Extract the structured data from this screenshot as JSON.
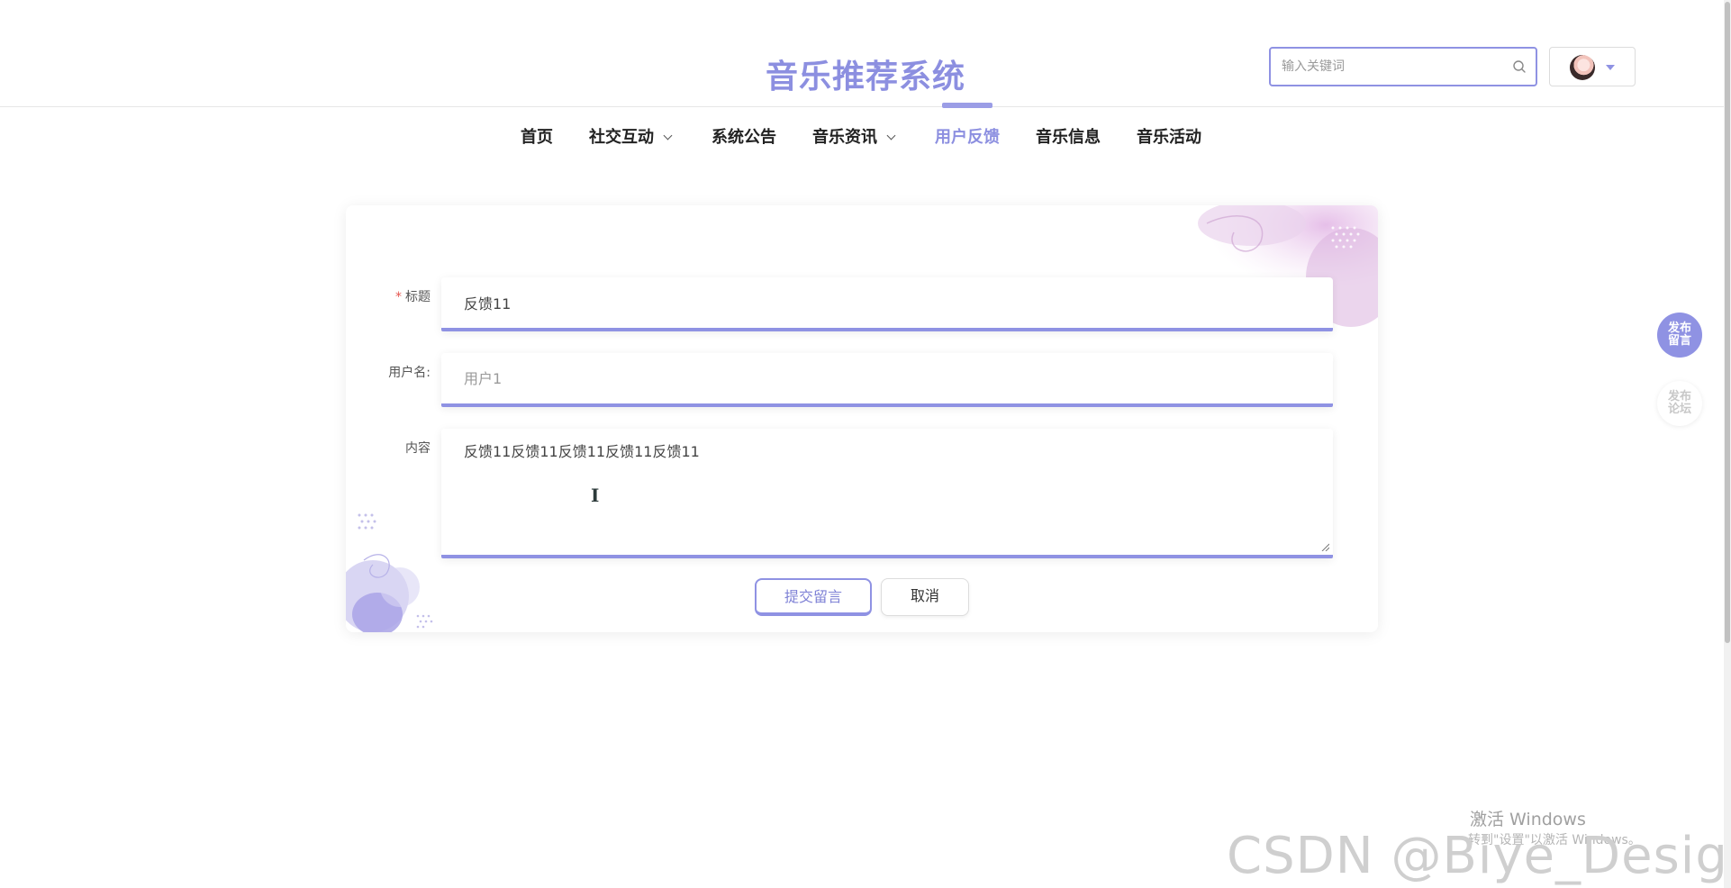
{
  "header": {
    "title": "音乐推荐系统",
    "search_placeholder": "输入关键词"
  },
  "nav": {
    "items": [
      {
        "label": "首页",
        "has_dropdown": false
      },
      {
        "label": "社交互动",
        "has_dropdown": true
      },
      {
        "label": "系统公告",
        "has_dropdown": false
      },
      {
        "label": "音乐资讯",
        "has_dropdown": true
      },
      {
        "label": "用户反馈",
        "has_dropdown": false,
        "active": true
      },
      {
        "label": "音乐信息",
        "has_dropdown": false
      },
      {
        "label": "音乐活动",
        "has_dropdown": false
      }
    ]
  },
  "form": {
    "title_label": "标题",
    "title_required_mark": "*",
    "title_value": "反馈11",
    "username_label": "用户名:",
    "username_placeholder": "用户1",
    "content_label": "内容",
    "content_value": "反馈11反馈11反馈11反馈11反馈11",
    "submit_label": "提交留言",
    "cancel_label": "取消"
  },
  "floating": {
    "post_message_line1": "发布",
    "post_message_line2": "留言",
    "post_forum_line1": "发布",
    "post_forum_line2": "论坛"
  },
  "overlays": {
    "windows_activation": "激活 Windows",
    "windows_activation_sub": "转到\"设置\"以激活 Windows。",
    "csdn_watermark": "CSDN @Biye_Design"
  },
  "colors": {
    "accent": "#8f92e3",
    "title": "#8c8fe0",
    "required": "#e5554f"
  },
  "icons": {
    "search": "search-icon",
    "caret": "caret-down-icon",
    "chevron": "chevron-down-icon",
    "text_cursor": "text-cursor-icon"
  }
}
